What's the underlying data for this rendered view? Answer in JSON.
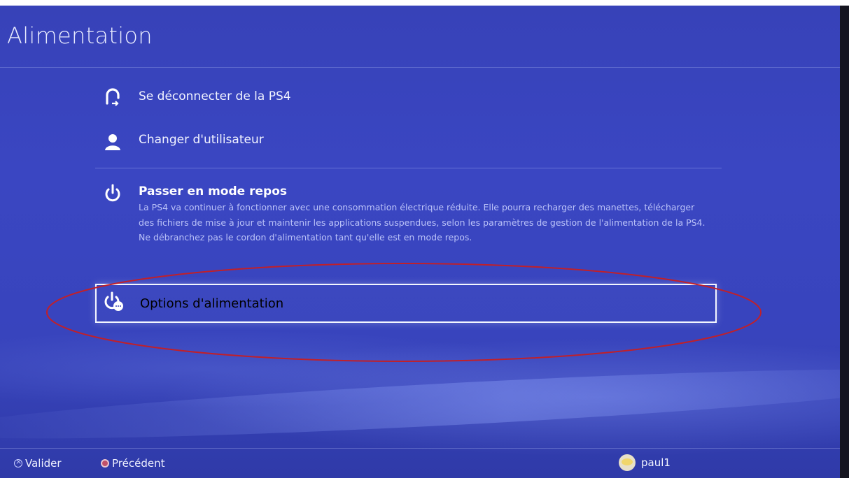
{
  "header": {
    "title": "Alimentation"
  },
  "menu": {
    "items": [
      {
        "label": "Se déconnecter de la PS4",
        "icon": "logout-icon"
      },
      {
        "label": "Changer d'utilisateur",
        "icon": "user-switch-icon"
      },
      {
        "label": "Passer en mode repos",
        "icon": "power-icon",
        "description": "La PS4 va continuer à fonctionner avec une consommation électrique réduite. Elle pourra recharger des manettes, télécharger des fichiers de mise à jour et maintenir les applications suspendues, selon les paramètres de gestion de l'alimentation de la PS4. Ne débranchez pas le cordon d'alimentation tant qu'elle est en mode repos."
      },
      {
        "label": "Options d'alimentation",
        "icon": "power-options-icon",
        "selected": true
      }
    ]
  },
  "footer": {
    "confirm_label": "Valider",
    "back_label": "Précédent",
    "username": "paul1"
  },
  "colors": {
    "background": "#3742b8",
    "highlight_border": "#f4f6ff",
    "annotation_ellipse": "#c0202a",
    "text": "#f1f3ff"
  }
}
